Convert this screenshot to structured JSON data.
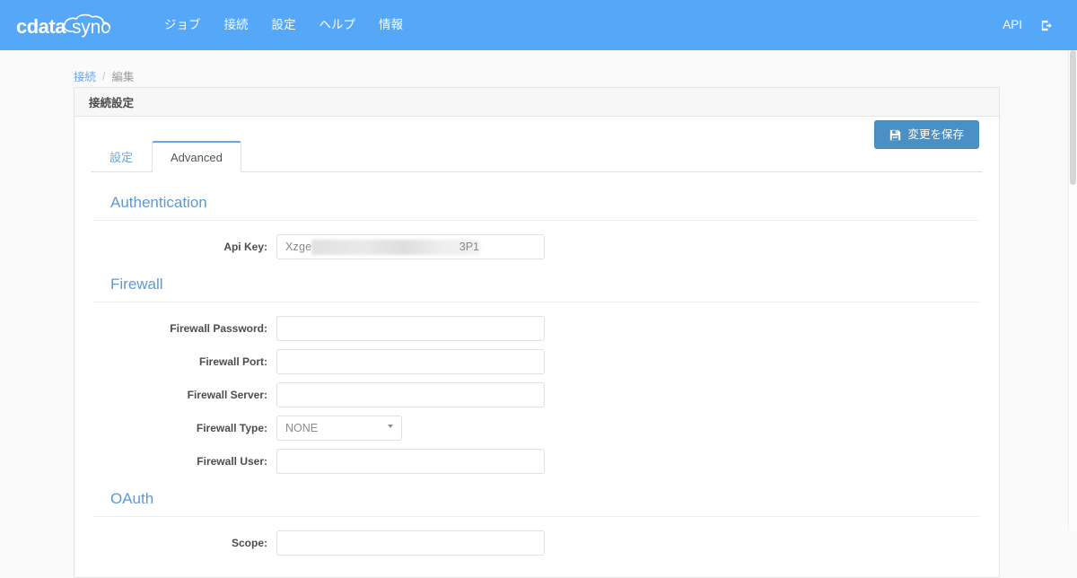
{
  "navbar": {
    "brand": "cdata sync",
    "brand_primary": "cdata",
    "brand_secondary": "sync",
    "links": [
      {
        "label": "ジョブ",
        "name": "nav-jobs"
      },
      {
        "label": "接続",
        "name": "nav-connections"
      },
      {
        "label": "設定",
        "name": "nav-settings"
      },
      {
        "label": "ヘルプ",
        "name": "nav-help"
      },
      {
        "label": "情報",
        "name": "nav-info"
      }
    ],
    "api_label": "API",
    "logout_icon": "sign-out-icon",
    "background_color": "#54a8f7"
  },
  "breadcrumb": {
    "parent": "接続",
    "separator": "/",
    "current": "編集"
  },
  "panel": {
    "heading": "接続設定"
  },
  "tabs": [
    {
      "label": "設定",
      "active": false
    },
    {
      "label": "Advanced",
      "active": true
    }
  ],
  "toolbar": {
    "save_label": "変更を保存",
    "save_icon": "floppy-disk-icon",
    "save_color": "#4a90c4"
  },
  "sections": {
    "authentication": {
      "title": "Authentication",
      "fields": [
        {
          "label": "Api Key:",
          "type": "redacted-text",
          "value_prefix": "Xzge",
          "value_suffix": "3P1",
          "placeholder": ""
        }
      ]
    },
    "firewall": {
      "title": "Firewall",
      "fields": [
        {
          "label": "Firewall Password:",
          "type": "text",
          "value": "",
          "placeholder": ""
        },
        {
          "label": "Firewall Port:",
          "type": "text",
          "value": "",
          "placeholder": ""
        },
        {
          "label": "Firewall Server:",
          "type": "text",
          "value": "",
          "placeholder": ""
        },
        {
          "label": "Firewall Type:",
          "type": "select",
          "value": "NONE",
          "options": [
            "NONE"
          ]
        },
        {
          "label": "Firewall User:",
          "type": "text",
          "value": "",
          "placeholder": ""
        }
      ]
    },
    "oauth": {
      "title": "OAuth",
      "fields": [
        {
          "label": "Scope:",
          "type": "text",
          "value": "",
          "placeholder": ""
        }
      ]
    }
  },
  "section_title_color": "#5b9bd5"
}
